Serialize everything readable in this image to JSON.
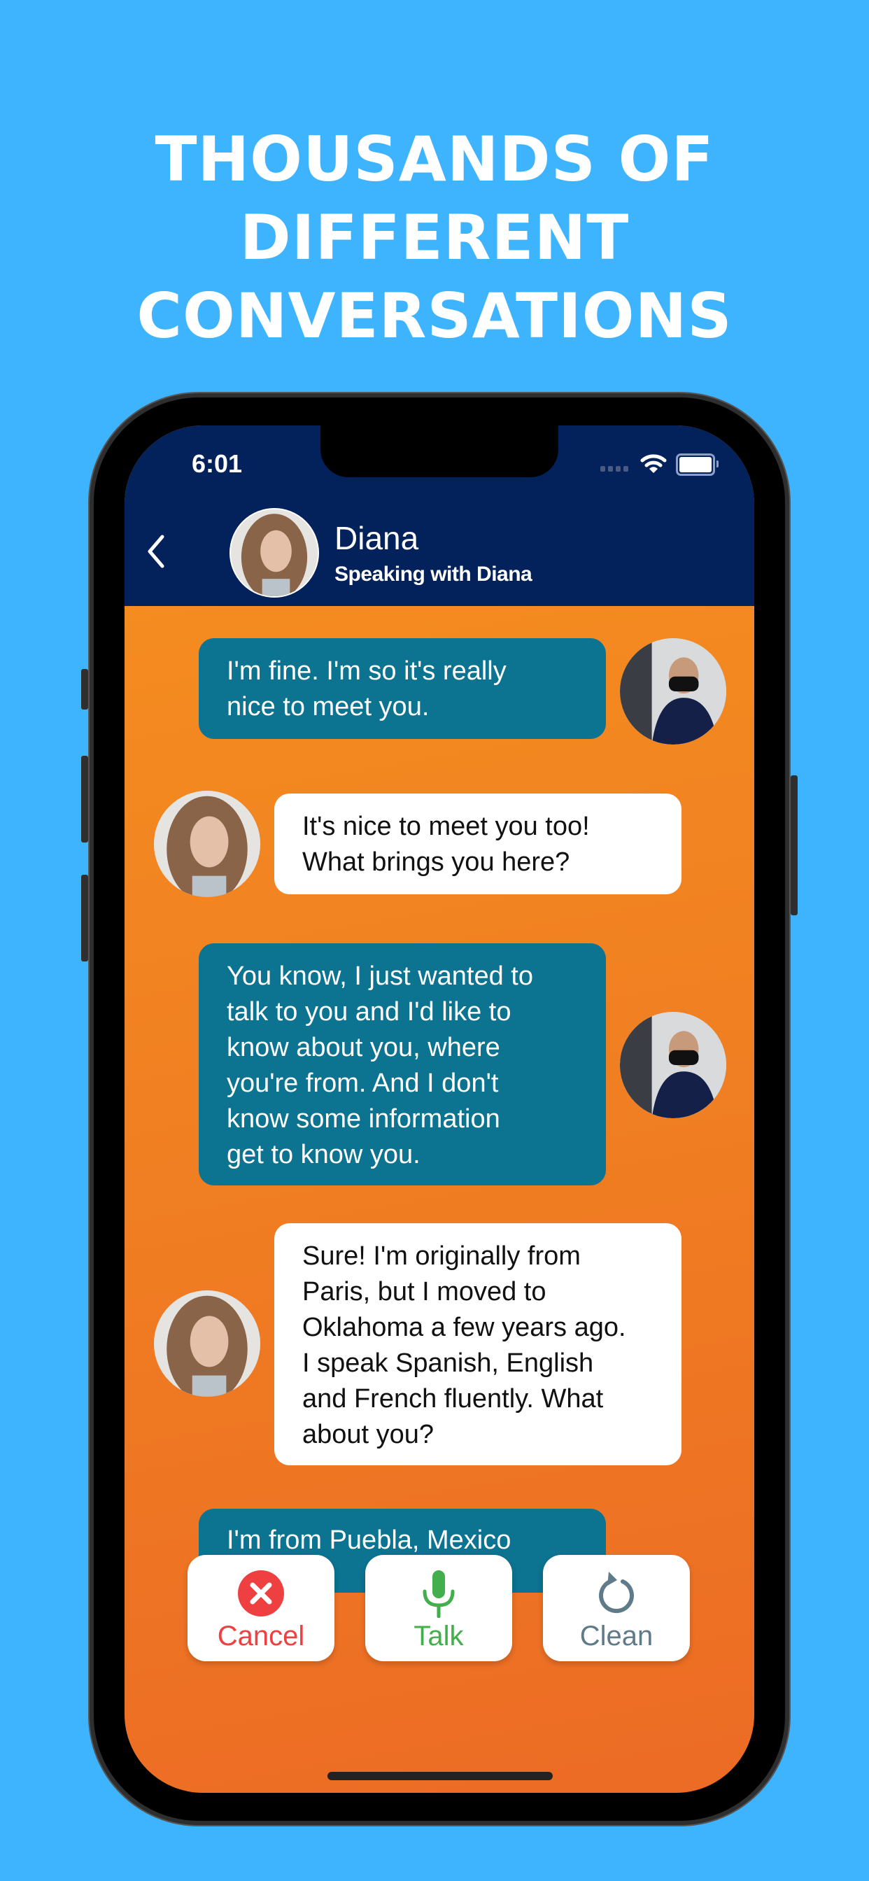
{
  "promo": {
    "headline_lines": [
      "THOUSANDS OF",
      "DIFFERENT",
      "CONVERSATIONS"
    ],
    "background_color": "#3fb4fe"
  },
  "status_bar": {
    "time": "6:01",
    "wifi_icon": "wifi-icon",
    "battery_icon": "battery-icon"
  },
  "header": {
    "back_icon": "chevron-left-icon",
    "contact_name": "Diana",
    "subtitle": "Speaking with Diana",
    "background_color": "#03215a"
  },
  "messages": [
    {
      "sender": "me",
      "lines": [
        "I'm fine. I'm so it's really",
        "nice to meet you."
      ]
    },
    {
      "sender": "diana",
      "lines": [
        "It's nice to meet you too!",
        "What brings you here?"
      ]
    },
    {
      "sender": "me",
      "lines": [
        "You know, I just wanted to",
        "talk to you and I'd like to",
        "know about you, where",
        "you're from. And I don't",
        "know some information",
        "get to know you."
      ]
    },
    {
      "sender": "diana",
      "lines": [
        "Sure! I'm originally from",
        "Paris, but I moved to",
        "Oklahoma a few years ago.",
        "I speak Spanish, English",
        "and French fluently. What",
        "about you?"
      ]
    },
    {
      "sender": "me",
      "lines": [
        "I'm from Puebla, Mexico"
      ]
    }
  ],
  "actions": [
    {
      "label": "Cancel",
      "icon": "close-circle-icon",
      "color": "#ee4040"
    },
    {
      "label": "Talk",
      "icon": "microphone-icon",
      "color": "#43ae4c"
    },
    {
      "label": "Clean",
      "icon": "refresh-icon",
      "color": "#5f7a88"
    }
  ],
  "colors": {
    "my_bubble": "#0c7390",
    "her_bubble": "#ffffff",
    "chat_background": "#f28422"
  }
}
